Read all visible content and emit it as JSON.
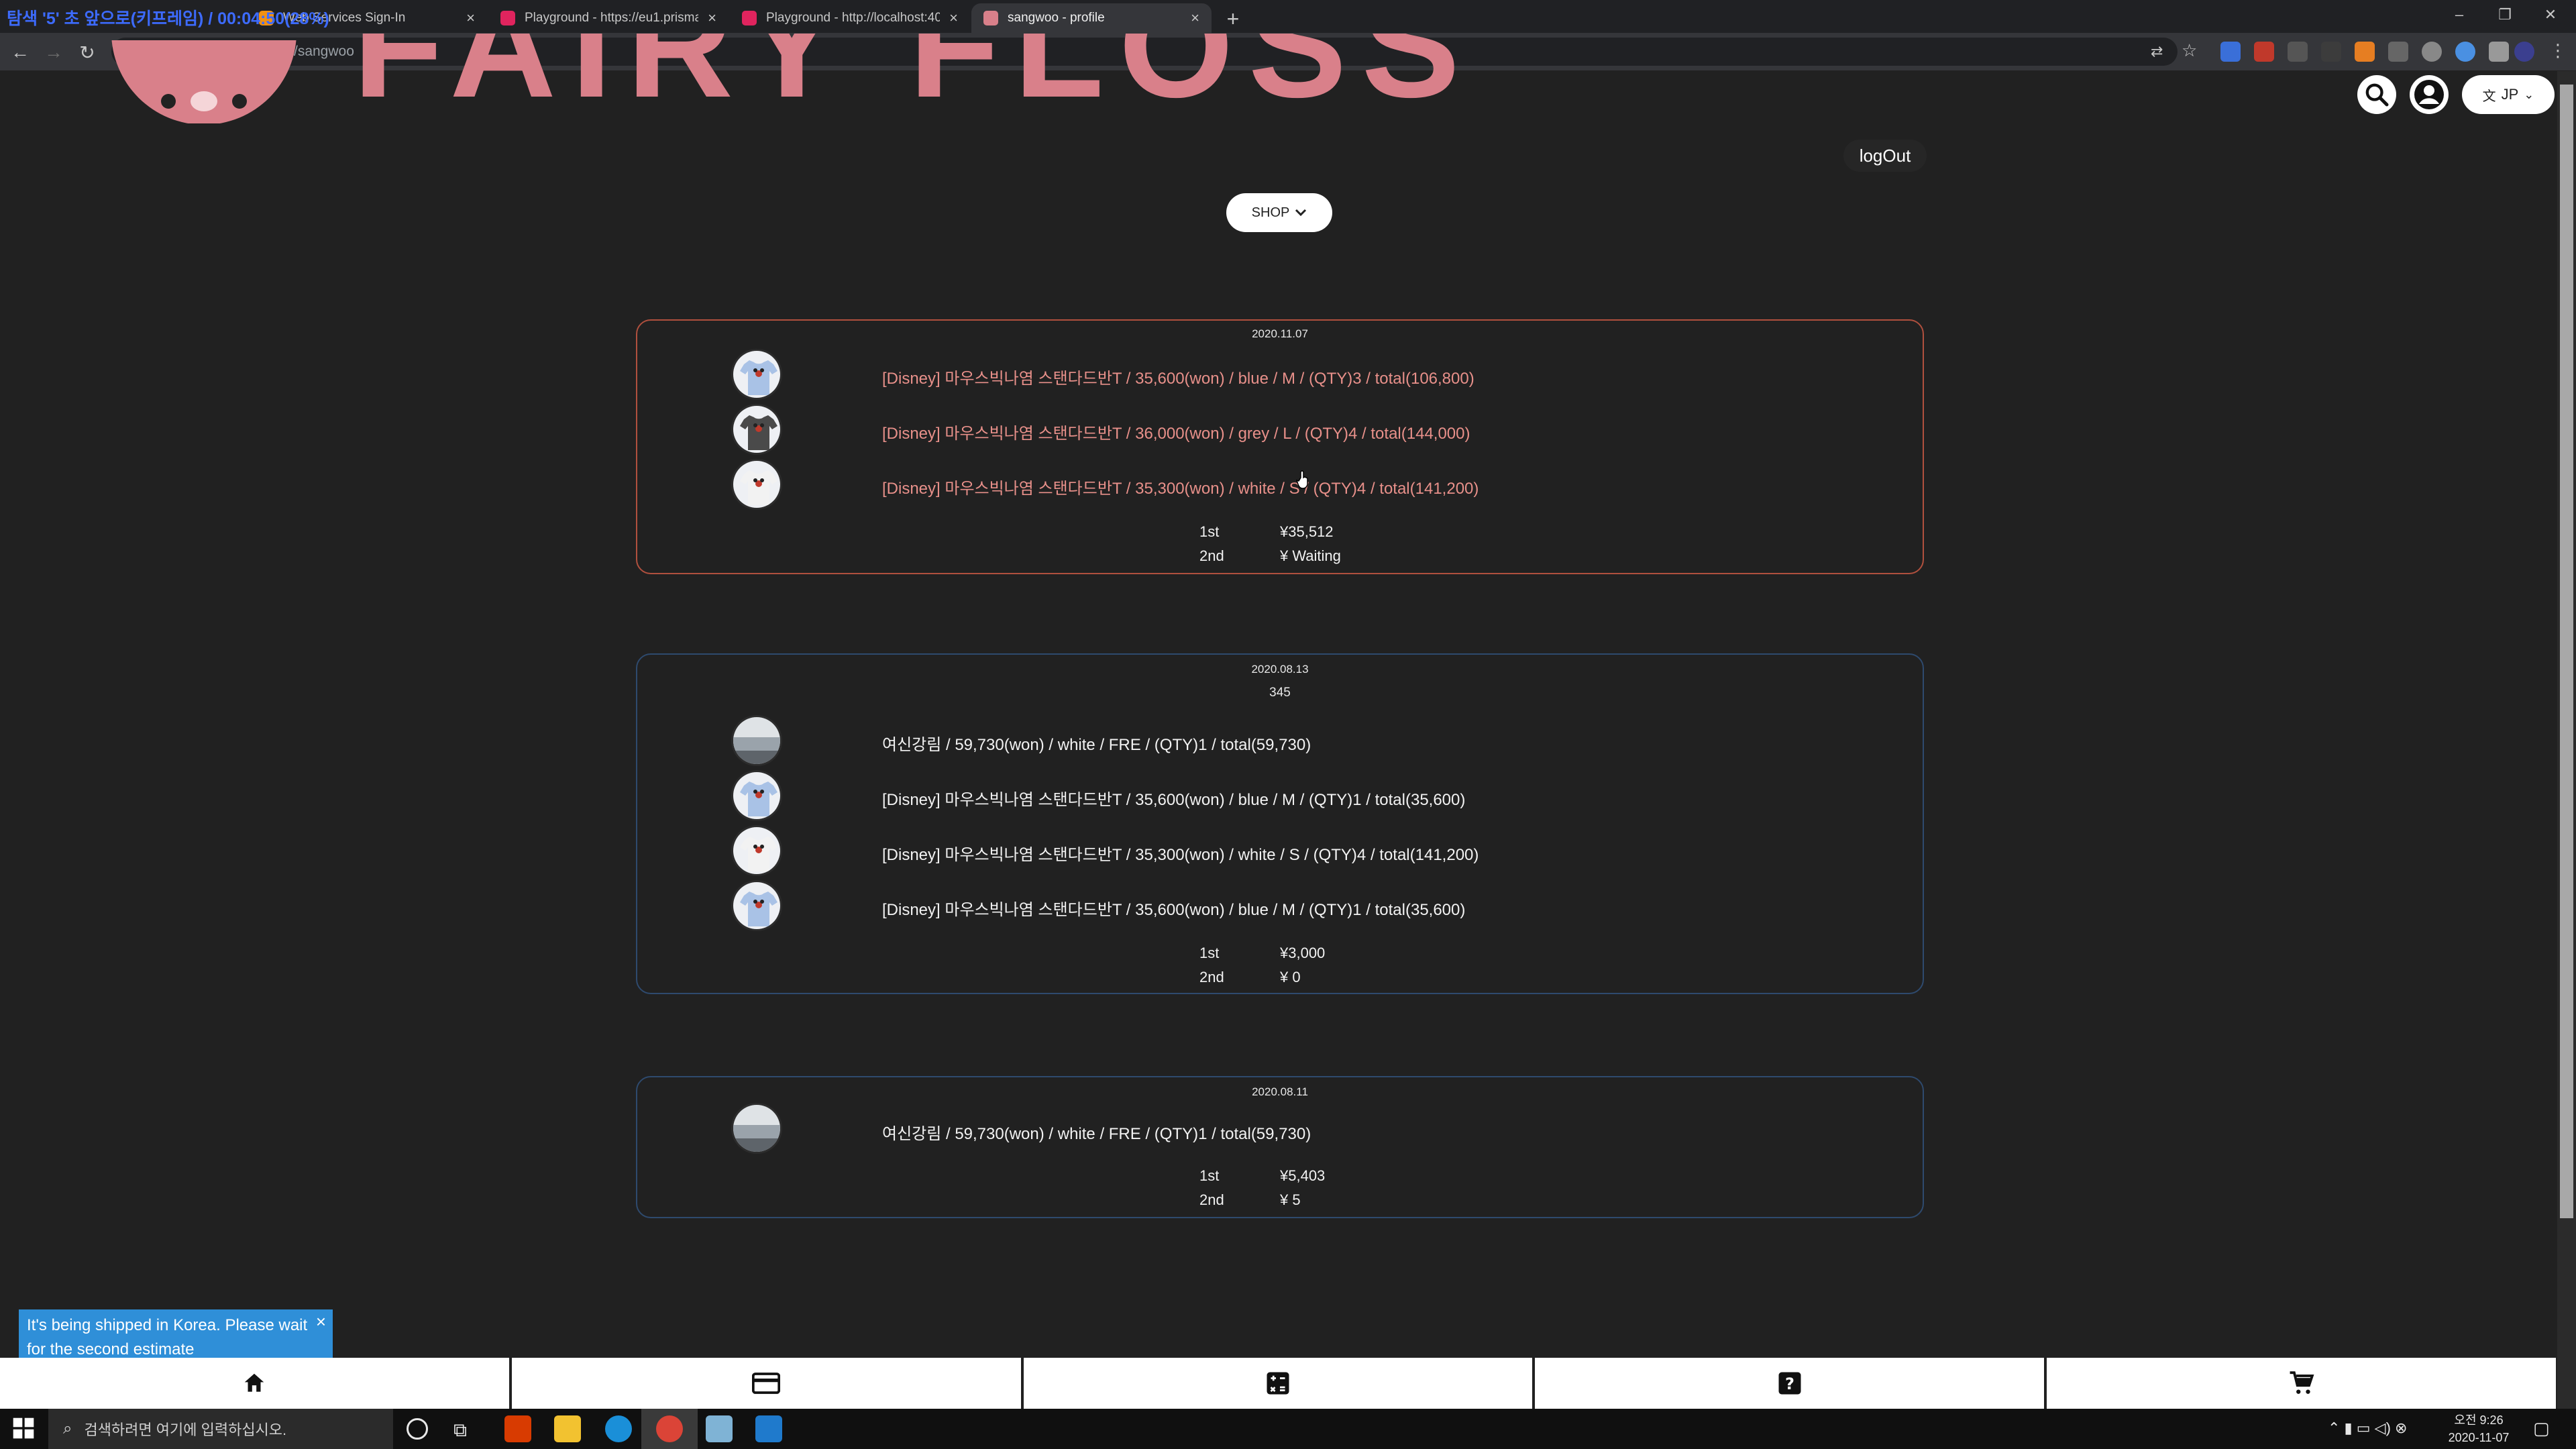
{
  "browser": {
    "overlay_text": "탐색 '5' 초 앞으로(키프레임) / 00:04:50(28%)",
    "tabs": [
      {
        "label": "Web Services Sign-In",
        "favicon_color": "#f29111"
      },
      {
        "label": "Playground - https://eu1.prisma",
        "favicon_color": "#e0245e"
      },
      {
        "label": "Playground - http://localhost:40",
        "favicon_color": "#e0245e"
      },
      {
        "label": "sangwoo - profile",
        "favicon_color": "#d9808a"
      }
    ],
    "tab_close": "×",
    "new_tab": "+",
    "url_host": "localhost",
    "url_path": ":3000/#/profile/sangwoo",
    "win_controls": [
      "–",
      "❐",
      "✕"
    ]
  },
  "header": {
    "logo_text": "FAIRY FLOSS",
    "language": "JP",
    "logout_label": "logOut",
    "shop_label": "SHOP"
  },
  "orders": [
    {
      "date": "2020.11.07",
      "note": "",
      "border_color": "#b0503e",
      "text_color": "#e8908a",
      "items": [
        {
          "text": "[Disney] 마우스빅나염 스탠다드반T / 35,600(won) / blue / M / (QTY)3 / total(106,800)",
          "shirt": "blue"
        },
        {
          "text": "[Disney] 마우스빅나염 스탠다드반T / 36,000(won) / grey / L / (QTY)4 / total(144,000)",
          "shirt": "grey"
        },
        {
          "text": "[Disney] 마우스빅나염 스탠다드반T / 35,300(won) / white / S / (QTY)4 / total(141,200)",
          "shirt": "white"
        }
      ],
      "estimates": {
        "first_label": "1st",
        "first_value": "¥35,512",
        "second_label": "2nd",
        "second_value": "¥ Waiting"
      }
    },
    {
      "date": "2020.08.13",
      "note": "345",
      "border_color": "#2e4a6e",
      "text_color": "#f2f2f2",
      "items": [
        {
          "text": "여신강림 / 59,730(won) / white / FRE / (QTY)1 / total(59,730)",
          "shirt": "photo"
        },
        {
          "text": "[Disney] 마우스빅나염 스탠다드반T / 35,600(won) / blue / M / (QTY)1 / total(35,600)",
          "shirt": "blue"
        },
        {
          "text": "[Disney] 마우스빅나염 스탠다드반T / 35,300(won) / white / S / (QTY)4 / total(141,200)",
          "shirt": "white"
        },
        {
          "text": "[Disney] 마우스빅나염 스탠다드반T / 35,600(won) / blue / M / (QTY)1 / total(35,600)",
          "shirt": "blue"
        }
      ],
      "estimates": {
        "first_label": "1st",
        "first_value": "¥3,000",
        "second_label": "2nd",
        "second_value": "¥ 0"
      }
    },
    {
      "date": "2020.08.11",
      "note": "",
      "border_color": "#2e4a6e",
      "text_color": "#f2f2f2",
      "items": [
        {
          "text": "여신강림 / 59,730(won) / white / FRE / (QTY)1 / total(59,730)",
          "shirt": "photo"
        }
      ],
      "estimates": {
        "first_label": "1st",
        "first_value": "¥5,403",
        "second_label": "2nd",
        "second_value": "¥ 5"
      }
    }
  ],
  "toast": {
    "message": "It's being shipped in Korea. Please wait for the second estimate",
    "close": "×"
  },
  "bottom_nav": [
    {
      "icon": "home-icon"
    },
    {
      "icon": "credit-card-icon"
    },
    {
      "icon": "calculator-icon"
    },
    {
      "icon": "question-icon"
    },
    {
      "icon": "cart-icon"
    }
  ],
  "taskbar": {
    "search_placeholder": "검색하려면 여기에 입력하십시오.",
    "time": "오전 9:26",
    "date": "2020-11-07"
  }
}
